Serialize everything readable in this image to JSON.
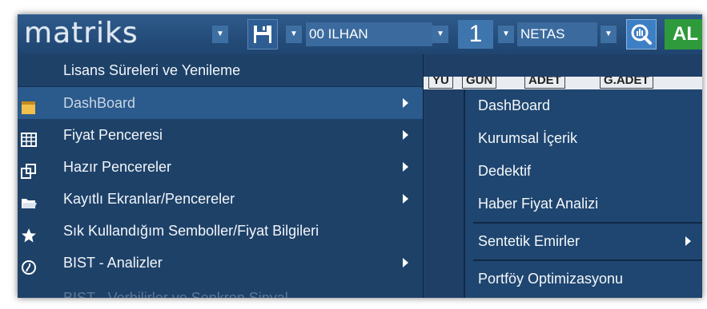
{
  "toolbar": {
    "logo": "matriks",
    "account_value": "00 ILHAN",
    "window_number": "1",
    "symbol_value": "NETAS",
    "buy_label": "AL"
  },
  "column_headers": [
    "YU",
    "GUN",
    "ADET",
    "G.ADET"
  ],
  "menu": {
    "items": [
      {
        "label": "Lisans Süreleri ve Yenileme",
        "icon": "none",
        "submenu": false
      },
      {
        "label": "DashBoard",
        "icon": "dashboard-icon",
        "submenu": true,
        "highlighted": true
      },
      {
        "label": "Fiyat Penceresi",
        "icon": "grid-table-icon",
        "submenu": true
      },
      {
        "label": "Hazır Pencereler",
        "icon": "windows-icon",
        "submenu": true
      },
      {
        "label": "Kayıtlı Ekranlar/Pencereler",
        "icon": "folder-icon",
        "submenu": true
      },
      {
        "label": "Sık Kullandığım Semboller/Fiyat Bilgileri",
        "icon": "star-icon",
        "submenu": false
      },
      {
        "label": "BIST - Analizler",
        "icon": "analysis-icon",
        "submenu": true
      }
    ],
    "partial_item": "BIST - Verbilirler ve Senkron Sinyal"
  },
  "submenu": {
    "items": [
      {
        "label": "DashBoard",
        "submenu": false
      },
      {
        "label": "Kurumsal İçerik",
        "submenu": false
      },
      {
        "label": "Dedektif",
        "submenu": false
      },
      {
        "label": "Haber Fiyat Analizi",
        "submenu": false
      },
      {
        "label": "Sentetik Emirler",
        "submenu": true
      },
      {
        "label": "Portföy Optimizasyonu",
        "submenu": false
      }
    ]
  },
  "colors": {
    "menu_bg": "#1e4168",
    "highlight_bg": "#2b5a8c",
    "buy_green": "#2e9a3c",
    "search_blue": "#3d7fc4"
  }
}
